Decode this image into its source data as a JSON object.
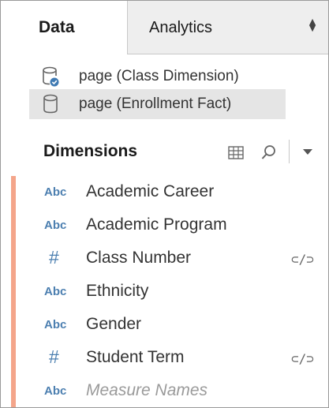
{
  "tabs": {
    "data_label": "Data",
    "analytics_label": "Analytics",
    "analytics_arrows": "⬍"
  },
  "data_sources": [
    {
      "label": "page (Class Dimension)",
      "icon": "database-linked-icon",
      "selected": false
    },
    {
      "label": "page (Enrollment Fact)",
      "icon": "database-icon",
      "selected": true
    }
  ],
  "dimensions": {
    "header": "Dimensions",
    "accent_color": "#f4a58a",
    "fields": [
      {
        "type": "Abc",
        "name": "Academic Career",
        "linked": false
      },
      {
        "type": "Abc",
        "name": "Academic Program",
        "linked": false
      },
      {
        "type": "#",
        "name": "Class Number",
        "linked": true
      },
      {
        "type": "Abc",
        "name": "Ethnicity",
        "linked": false
      },
      {
        "type": "Abc",
        "name": "Gender",
        "linked": false
      },
      {
        "type": "#",
        "name": "Student Term",
        "linked": true
      },
      {
        "type": "Abc",
        "name": "Measure Names",
        "linked": false
      }
    ],
    "link_glyph": "⊂/⊃"
  }
}
